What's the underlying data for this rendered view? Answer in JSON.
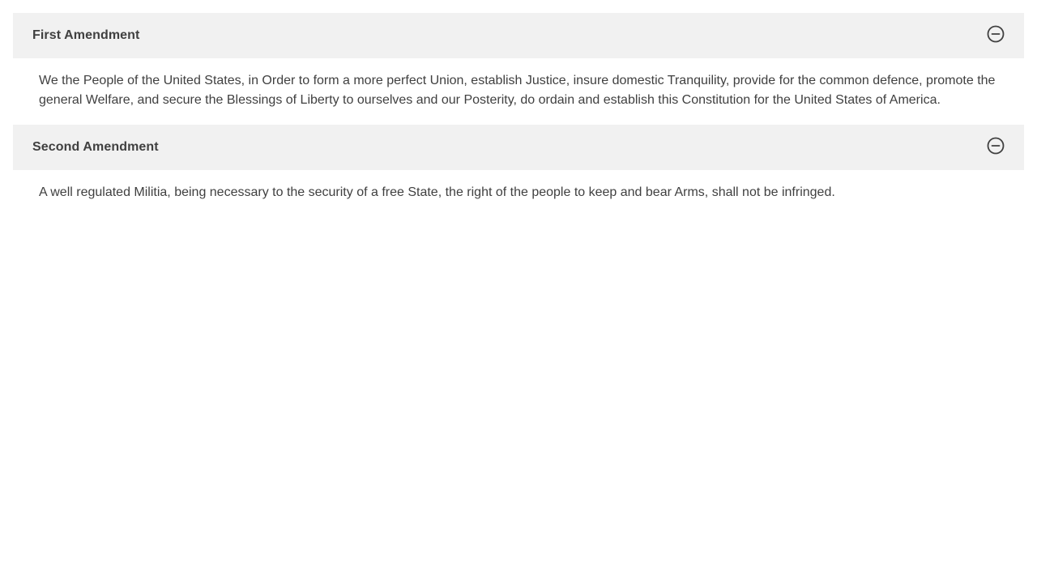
{
  "accordion": {
    "items": [
      {
        "title": "First Amendment",
        "toggle_icon": "minus-circle-icon",
        "expanded": true,
        "body": "We the People of the United States, in Order to form a more perfect Union, establish Justice, insure domestic Tranquility, provide for the common defence, promote the general Welfare, and secure the Blessings of Liberty to ourselves and our Posterity, do ordain and establish this Constitution for the United States of America."
      },
      {
        "title": "Second Amendment",
        "toggle_icon": "minus-circle-icon",
        "expanded": true,
        "body": "A well regulated Militia, being necessary to the security of a free State, the right of the people to keep and bear Arms, shall not be infringed."
      }
    ]
  },
  "colors": {
    "header_bg": "#f1f1f1",
    "text": "#404040",
    "background": "#ffffff"
  }
}
